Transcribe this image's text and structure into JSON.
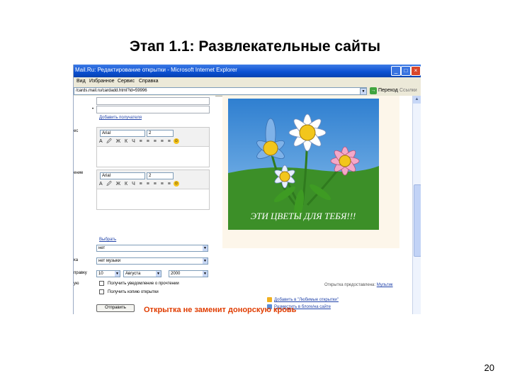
{
  "slide": {
    "title": "Этап 1.1: Развлекательные сайты",
    "page_number": "20",
    "notice": "Открытка не заменит донорскую кровь"
  },
  "window": {
    "title": "Mail.Ru: Редактирование открытки - Microsoft Internet Explorer",
    "menu": [
      "Вид",
      "Избранное",
      "Сервис",
      "Справка"
    ],
    "address": "/cards.mail.ru/cardadd.html?id=59996",
    "go_label": "Переход",
    "links_label": "Ссылки"
  },
  "form": {
    "add_contact_link": "Добавить получателя",
    "side_label_1": "ес",
    "side_label_2": "ение",
    "editor": {
      "font_value": "Arial",
      "size_value": "2",
      "toolbar_glyphs": "A 🖉 Ж К Ч ≡ ≡ ≡ ≡ ≡"
    },
    "choose_link": "Выбрать",
    "select_1": "нет",
    "select_2_label": "ка",
    "select_2": "нет музыки",
    "date_label": "правку",
    "date_day": "10",
    "date_month": "Августа",
    "date_year": "2000",
    "side_label_3": "ую",
    "checkbox_1": "Получить уведомление о прочтении",
    "checkbox_2": "Получить копию открытки",
    "submit_label": "Отправить"
  },
  "card": {
    "caption": "ЭТИ ЦВЕТЫ ДЛЯ ТЕБЯ!!!",
    "provided_by": "Открытка предоставлена:",
    "provider_link": "Мультик",
    "action_1": "Добавить в \"Любимые открытки\"",
    "action_2": "Разместить в блоге/на сайте"
  },
  "colors": {
    "ie_titlebar": "#0a4fd1",
    "notice": "#e03c00",
    "card_sky": "#4a8fd6",
    "card_grass": "#3c8f28"
  }
}
